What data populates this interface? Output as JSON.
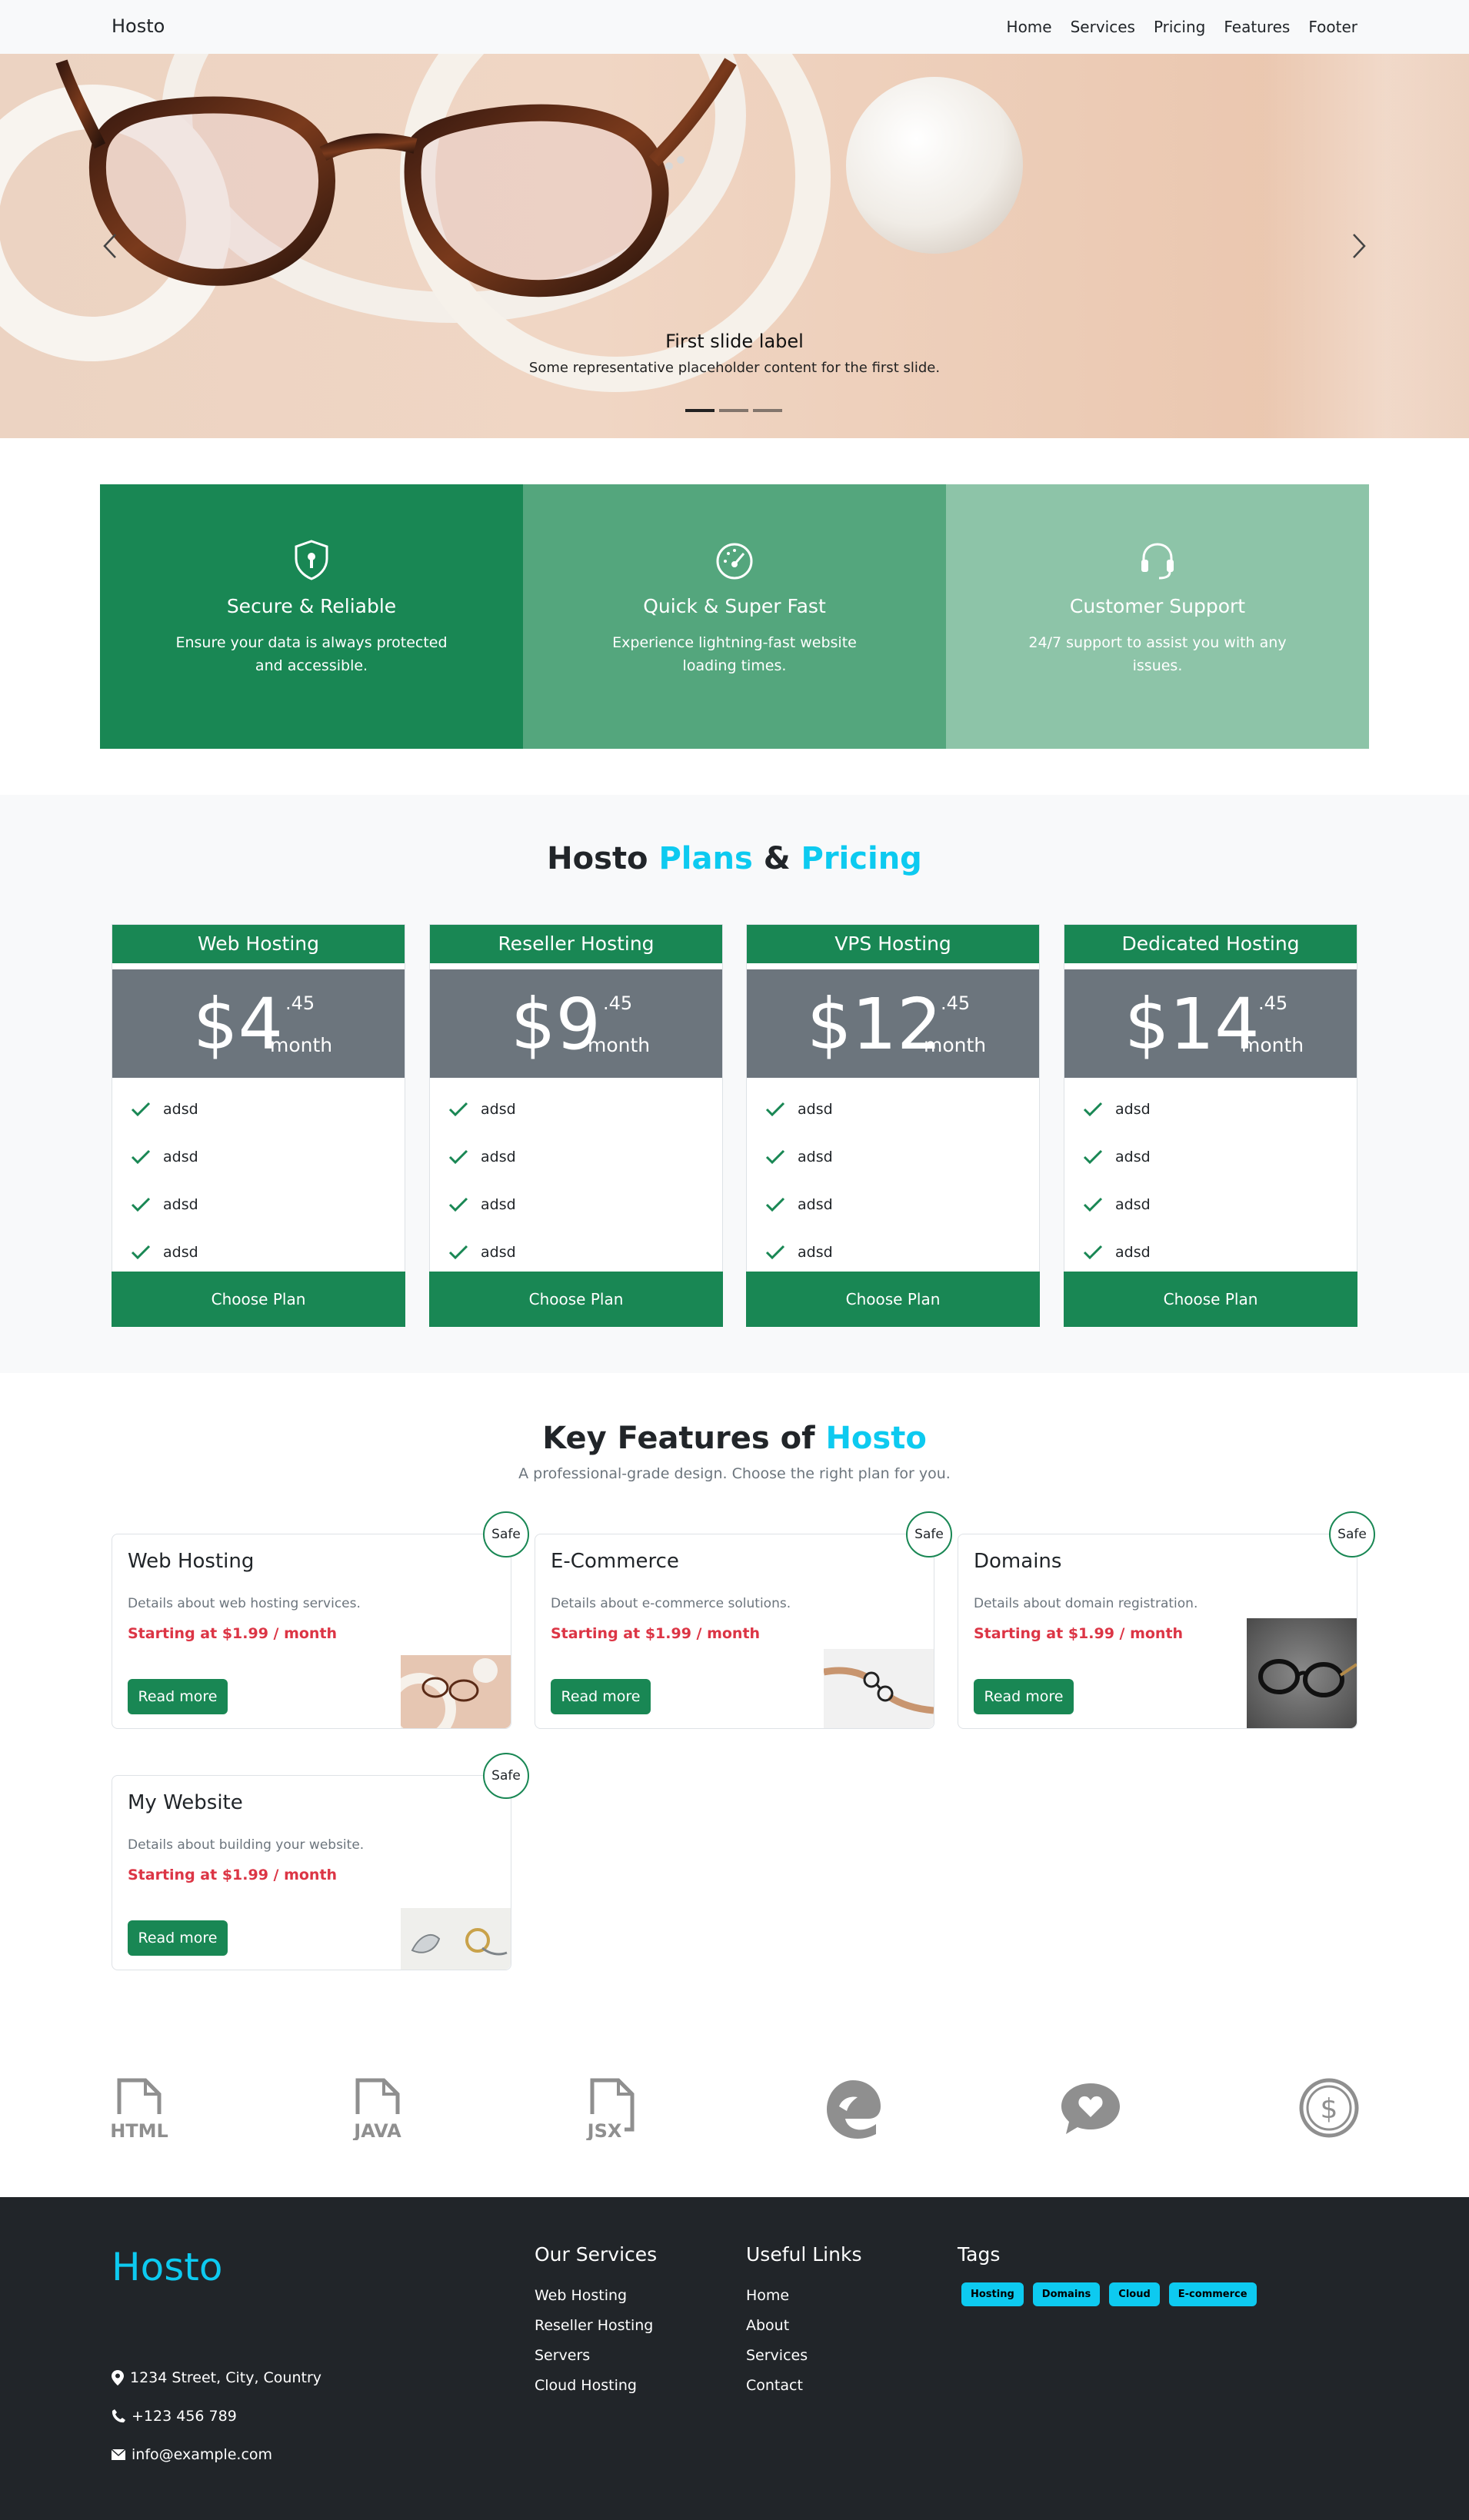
{
  "navbar": {
    "brand": "Hosto",
    "links": [
      "Home",
      "Services",
      "Pricing",
      "Features",
      "Footer"
    ]
  },
  "hero": {
    "caption_title": "First slide label",
    "caption_text": "Some representative placeholder content for the first slide.",
    "active_slide": 1,
    "slide_count": 3
  },
  "features_strip": [
    {
      "icon": "shield-icon",
      "title": "Secure & Reliable",
      "text": "Ensure your data is always protected and accessible.",
      "color": "#198754"
    },
    {
      "icon": "speedometer-icon",
      "title": "Quick & Super Fast",
      "text": "Experience lightning-fast website loading times.",
      "color": "#54a67d"
    },
    {
      "icon": "headset-icon",
      "title": "Customer Support",
      "text": "24/7 support to assist you with any issues.",
      "color": "#8dc4a8"
    }
  ],
  "pricing": {
    "title_a": "Hosto ",
    "title_b": "Plans",
    "title_c": " & ",
    "title_d": "Pricing",
    "plans": [
      {
        "name": "Web Hosting",
        "amount": "$4",
        "cents": ".45",
        "period": "month",
        "features": [
          "adsd",
          "adsd",
          "adsd",
          "adsd"
        ],
        "button": "Choose Plan"
      },
      {
        "name": "Reseller Hosting",
        "amount": "$9",
        "cents": ".45",
        "period": "month",
        "features": [
          "adsd",
          "adsd",
          "adsd",
          "adsd"
        ],
        "button": "Choose Plan"
      },
      {
        "name": "VPS Hosting",
        "amount": "$12",
        "cents": ".45",
        "period": "month",
        "features": [
          "adsd",
          "adsd",
          "adsd",
          "adsd"
        ],
        "button": "Choose Plan"
      },
      {
        "name": "Dedicated Hosting",
        "amount": "$14",
        "cents": ".45",
        "period": "month",
        "features": [
          "adsd",
          "adsd",
          "adsd",
          "adsd"
        ],
        "button": "Choose Plan"
      }
    ]
  },
  "key_features": {
    "title_a": "Key Features of ",
    "title_b": "Hosto",
    "subtitle": "A professional-grade design. Choose the right plan for you.",
    "cards": [
      {
        "title": "Web Hosting",
        "text": "Details about web hosting services.",
        "price": "Starting at $1.99 / month",
        "button": "Read more",
        "badge": "Safe"
      },
      {
        "title": "E-Commerce",
        "text": "Details about e-commerce solutions.",
        "price": "Starting at $1.99 / month",
        "button": "Read more",
        "badge": "Safe"
      },
      {
        "title": "Domains",
        "text": "Details about domain registration.",
        "price": "Starting at $1.99 / month",
        "button": "Read more",
        "badge": "Safe"
      },
      {
        "title": "My Website",
        "text": "Details about building your website.",
        "price": "Starting at $1.99 / month",
        "button": "Read more",
        "badge": "Safe"
      }
    ]
  },
  "tech_icons": [
    {
      "name": "html-file-icon",
      "label": "HTML"
    },
    {
      "name": "java-file-icon",
      "label": "JAVA"
    },
    {
      "name": "jsx-file-icon",
      "label": "JSX"
    },
    {
      "name": "edge-icon",
      "label": ""
    },
    {
      "name": "heart-chat-icon",
      "label": ""
    },
    {
      "name": "dollar-coin-icon",
      "label": ""
    }
  ],
  "footer": {
    "brand": "Hosto",
    "address": "1234 Street, City, Country",
    "phone": "+123 456 789",
    "email": "info@example.com",
    "services_title": "Our Services",
    "services": [
      "Web Hosting",
      "Reseller Hosting",
      "Servers",
      "Cloud Hosting"
    ],
    "links_title": "Useful Links",
    "links": [
      "Home",
      "About",
      "Services",
      "Contact"
    ],
    "tags_title": "Tags",
    "tags": [
      "Hosting",
      "Domains",
      "Cloud",
      "E-commerce"
    ]
  }
}
